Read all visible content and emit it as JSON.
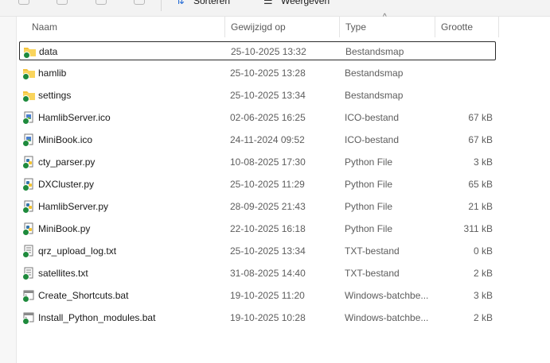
{
  "toolbar": {
    "sort_label": "Sorteren",
    "view_label": "Weergeven"
  },
  "columns": {
    "name": "Naam",
    "modified": "Gewijzigd op",
    "type": "Type",
    "size": "Grootte",
    "sorted_column": "Type"
  },
  "files": [
    {
      "name": "data",
      "modified": "25-10-2025 13:32",
      "type": "Bestandsmap",
      "size": "",
      "icon": "folder-icon",
      "selected": true
    },
    {
      "name": "hamlib",
      "modified": "25-10-2025 13:28",
      "type": "Bestandsmap",
      "size": "",
      "icon": "folder-icon"
    },
    {
      "name": "settings",
      "modified": "25-10-2025 13:34",
      "type": "Bestandsmap",
      "size": "",
      "icon": "folder-icon"
    },
    {
      "name": "HamlibServer.ico",
      "modified": "02-06-2025 16:25",
      "type": "ICO-bestand",
      "size": "67 kB",
      "icon": "ico-file-icon"
    },
    {
      "name": "MiniBook.ico",
      "modified": "24-11-2024 09:52",
      "type": "ICO-bestand",
      "size": "67 kB",
      "icon": "ico-file-icon"
    },
    {
      "name": "cty_parser.py",
      "modified": "10-08-2025 17:30",
      "type": "Python File",
      "size": "3 kB",
      "icon": "python-file-icon"
    },
    {
      "name": "DXCluster.py",
      "modified": "25-10-2025 11:29",
      "type": "Python File",
      "size": "65 kB",
      "icon": "python-file-icon"
    },
    {
      "name": "HamlibServer.py",
      "modified": "28-09-2025 21:43",
      "type": "Python File",
      "size": "21 kB",
      "icon": "python-file-icon"
    },
    {
      "name": "MiniBook.py",
      "modified": "22-10-2025 16:18",
      "type": "Python File",
      "size": "311 kB",
      "icon": "python-file-icon"
    },
    {
      "name": "qrz_upload_log.txt",
      "modified": "25-10-2025 13:34",
      "type": "TXT-bestand",
      "size": "0 kB",
      "icon": "text-file-icon"
    },
    {
      "name": "satellites.txt",
      "modified": "31-08-2025 14:40",
      "type": "TXT-bestand",
      "size": "2 kB",
      "icon": "text-file-icon"
    },
    {
      "name": "Create_Shortcuts.bat",
      "modified": "19-10-2025 11:20",
      "type": "Windows-batchbe...",
      "size": "3 kB",
      "icon": "batch-file-icon"
    },
    {
      "name": "Install_Python_modules.bat",
      "modified": "19-10-2025 10:28",
      "type": "Windows-batchbe...",
      "size": "2 kB",
      "icon": "batch-file-icon"
    }
  ],
  "colors": {
    "folder": "#f4c23a",
    "sync_ok": "#1e8a3c",
    "accent": "#2a6fd6"
  }
}
